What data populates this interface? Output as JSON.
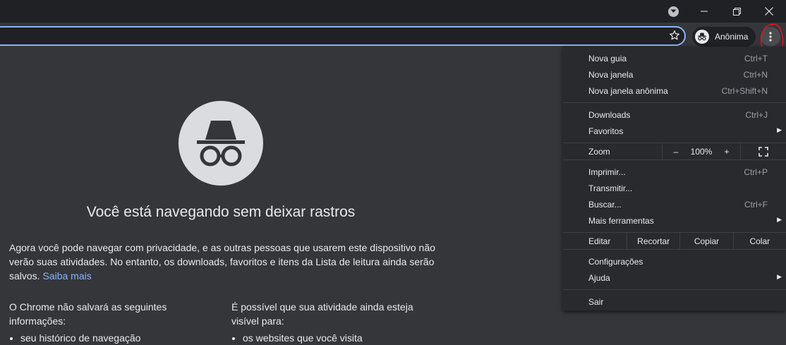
{
  "window": {
    "controls": [
      "tab-search",
      "minimize",
      "maximize",
      "close"
    ]
  },
  "toolbar": {
    "profile_label": "Anônima"
  },
  "page": {
    "title": "Você está navegando sem deixar rastros",
    "intro": "Agora você pode navegar com privacidade, e as outras pessoas que usarem este dispositivo não verão suas atividades. No entanto, os downloads, favoritos e itens da Lista de leitura ainda serão salvos.",
    "learn_more": "Saiba mais",
    "col1_heading": "O Chrome não salvará as seguintes informações:",
    "col1_items": [
      "seu histórico de navegação"
    ],
    "col2_heading": "É possível que sua atividade ainda esteja visível para:",
    "col2_items": [
      "os websites que você visita"
    ]
  },
  "menu": {
    "new_tab": {
      "label": "Nova guia",
      "shortcut": "Ctrl+T"
    },
    "new_window": {
      "label": "Nova janela",
      "shortcut": "Ctrl+N"
    },
    "new_incognito": {
      "label": "Nova janela anônima",
      "shortcut": "Ctrl+Shift+N"
    },
    "downloads": {
      "label": "Downloads",
      "shortcut": "Ctrl+J"
    },
    "bookmarks": {
      "label": "Favoritos"
    },
    "zoom": {
      "label": "Zoom",
      "minus": "–",
      "value": "100%",
      "plus": "+"
    },
    "print": {
      "label": "Imprimir...",
      "shortcut": "Ctrl+P"
    },
    "cast": {
      "label": "Transmitir..."
    },
    "find": {
      "label": "Buscar...",
      "shortcut": "Ctrl+F"
    },
    "more_tools": {
      "label": "Mais ferramentas"
    },
    "edit": {
      "label": "Editar",
      "cut": "Recortar",
      "copy": "Copiar",
      "paste": "Colar"
    },
    "settings": {
      "label": "Configurações"
    },
    "help": {
      "label": "Ajuda"
    },
    "exit": {
      "label": "Sair"
    }
  },
  "colors": {
    "accent": "#8ab4f8",
    "annotation": "#e0141e"
  }
}
